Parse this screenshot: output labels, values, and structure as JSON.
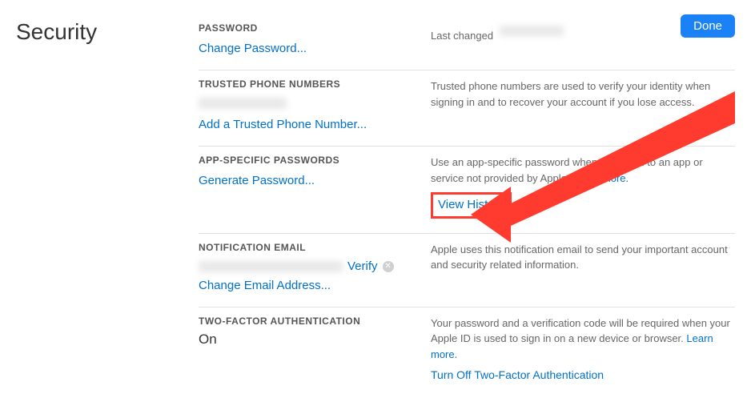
{
  "page": {
    "title": "Security",
    "done": "Done"
  },
  "password": {
    "heading": "PASSWORD",
    "change_link": "Change Password...",
    "last_changed_label": "Last changed"
  },
  "trusted_phones": {
    "heading": "TRUSTED PHONE NUMBERS",
    "add_link": "Add a Trusted Phone Number...",
    "description": "Trusted phone numbers are used to verify your identity when signing in and to recover your account if you lose access."
  },
  "app_passwords": {
    "heading": "APP-SPECIFIC PASSWORDS",
    "generate_link": "Generate Password...",
    "description": "Use an app-specific password when signing in to an app or service not provided by Apple.",
    "learn_more": "Learn more.",
    "view_history": "View History"
  },
  "notification_email": {
    "heading": "NOTIFICATION EMAIL",
    "verify": "Verify",
    "change_link": "Change Email Address...",
    "description": "Apple uses this notification email to send your important account and security related information."
  },
  "two_factor": {
    "heading": "TWO-FACTOR AUTHENTICATION",
    "status": "On",
    "description": "Your password and a verification code will be required when your Apple ID is used to sign in on a new device or browser.",
    "learn_more": "Learn more.",
    "turn_off": "Turn Off Two-Factor Authentication"
  }
}
